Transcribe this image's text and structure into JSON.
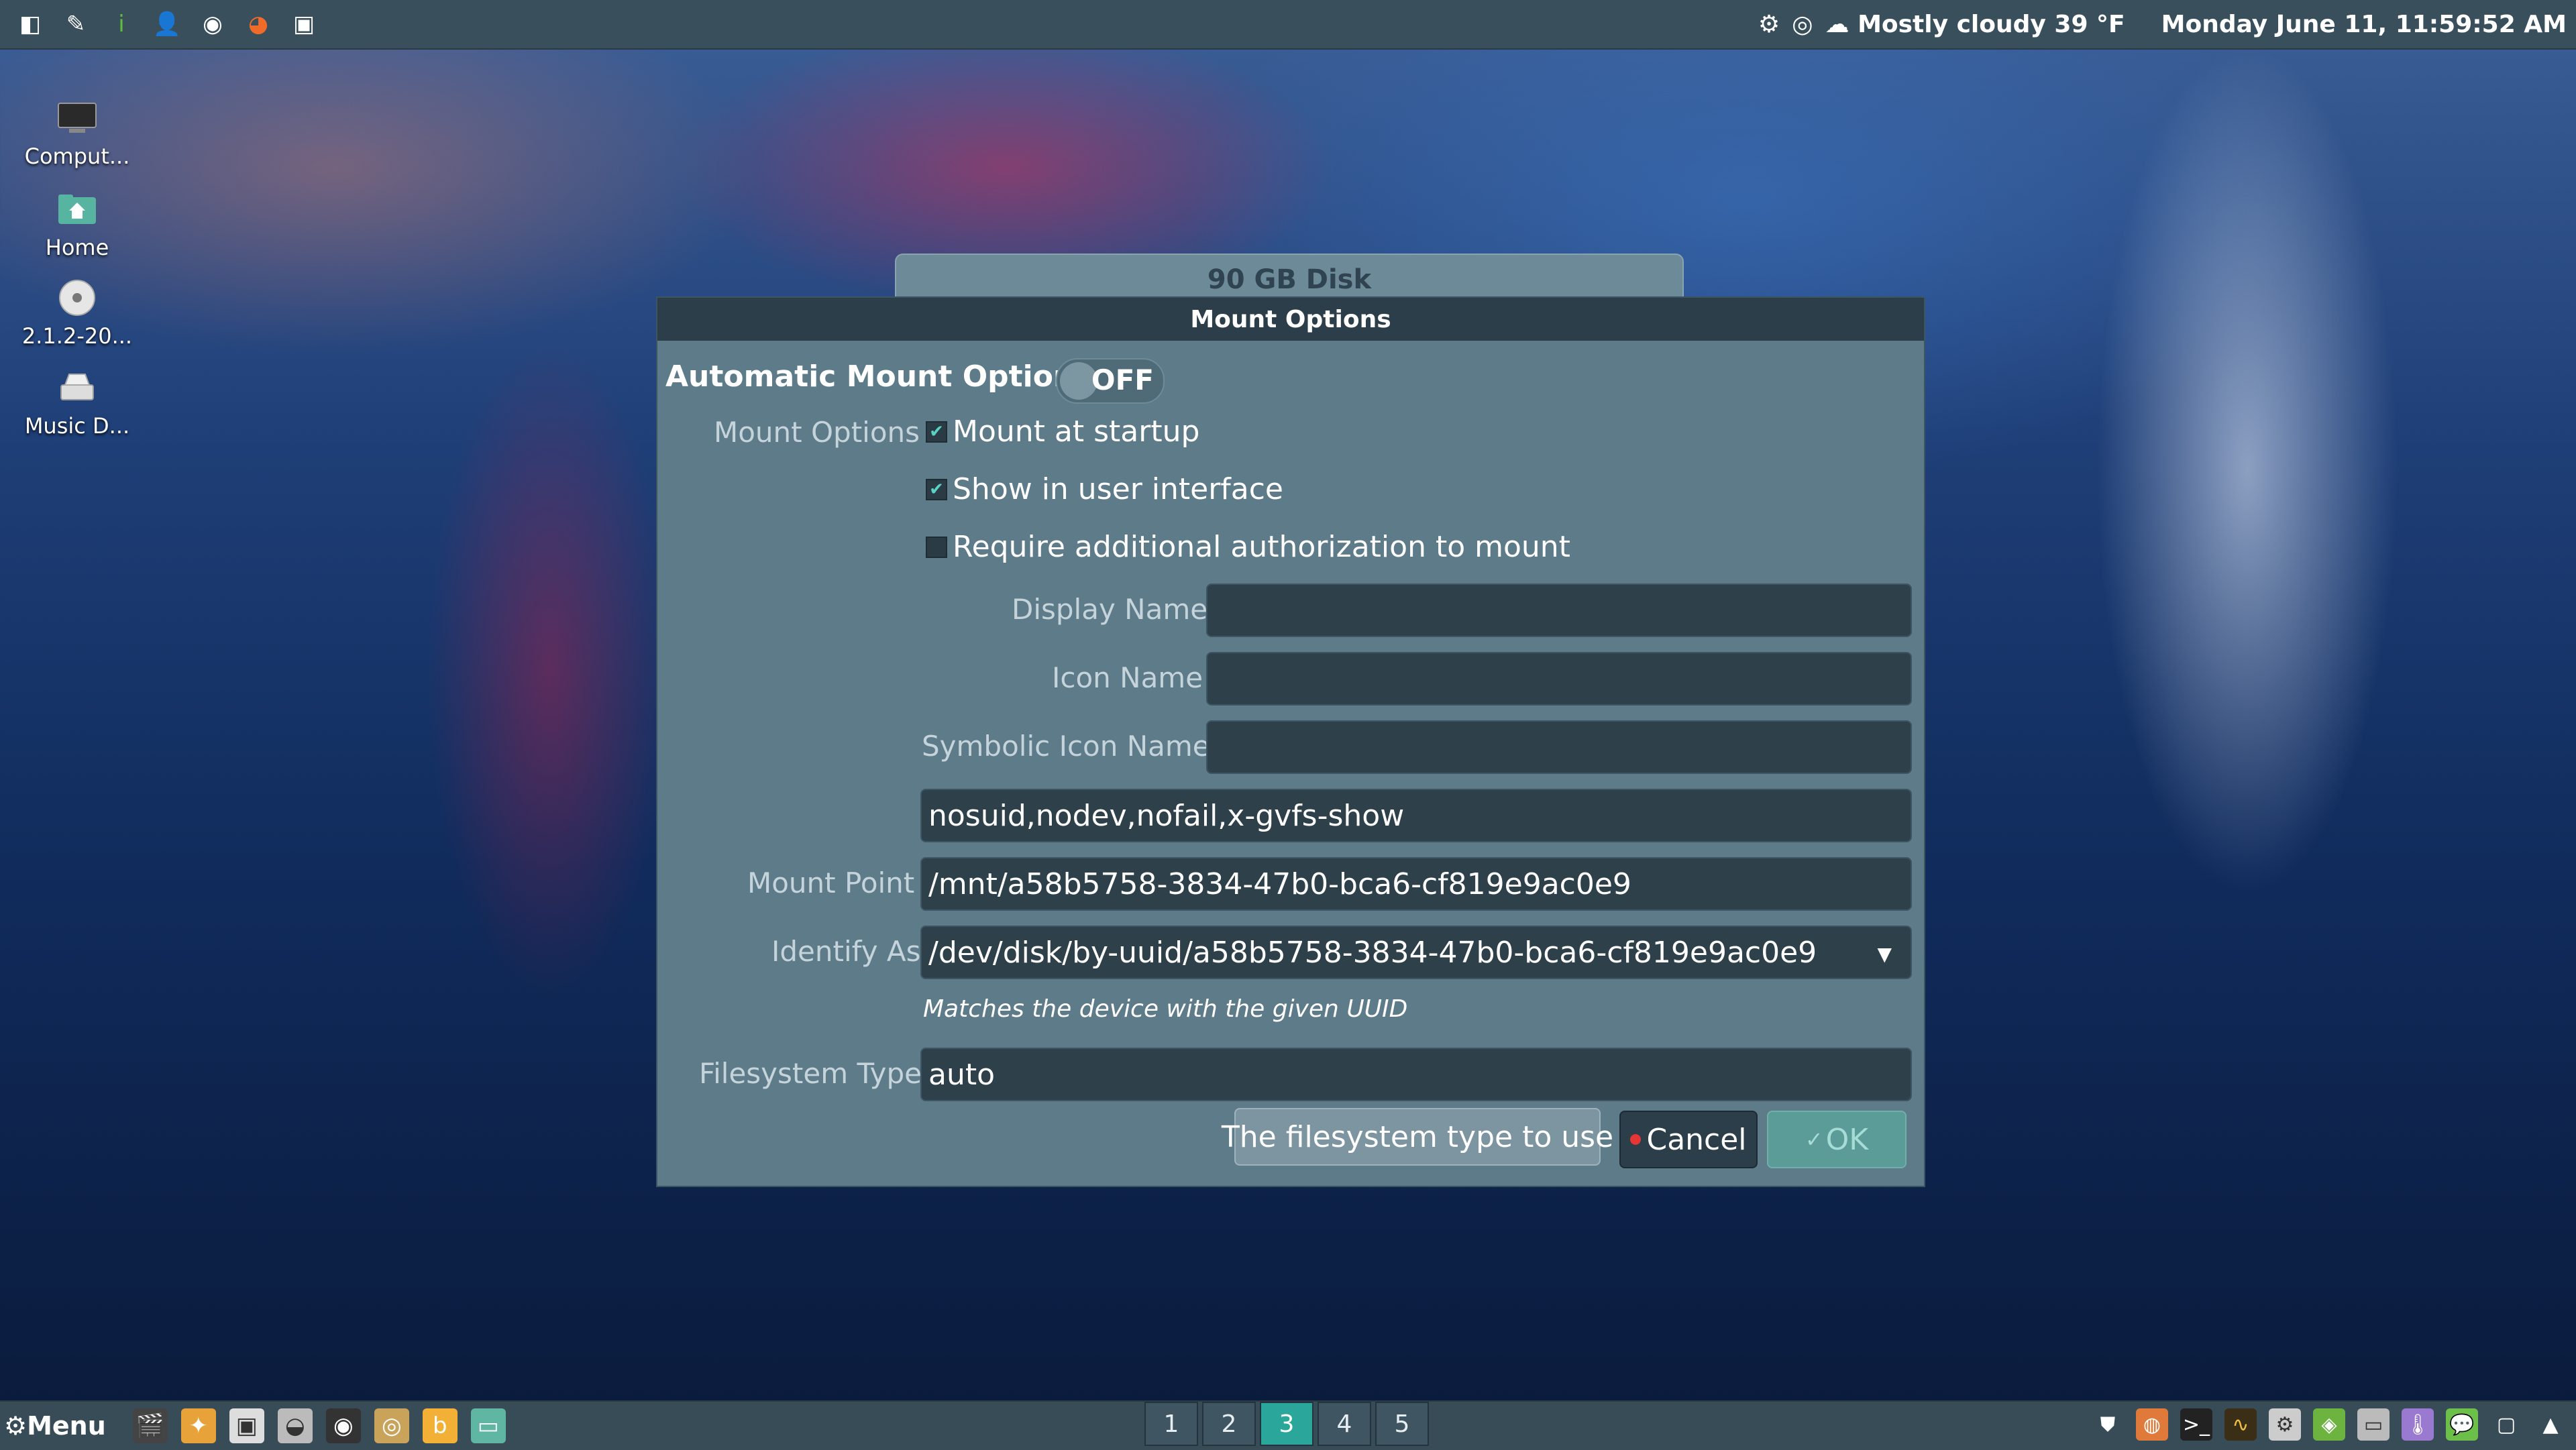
{
  "topbar": {
    "launchers": [
      {
        "icon": "file-manager-icon",
        "glyph": "◧",
        "color": "#ffffff"
      },
      {
        "icon": "pen-icon",
        "glyph": "✎",
        "color": "#ffffff"
      },
      {
        "icon": "info-icon",
        "glyph": "i",
        "color": "#5cbf3a"
      },
      {
        "icon": "user-icon",
        "glyph": "👤",
        "color": "#ffffff"
      },
      {
        "icon": "disc-icon",
        "glyph": "◉",
        "color": "#ffffff"
      },
      {
        "icon": "firefox-icon",
        "glyph": "◕",
        "color": "#f06a2a"
      },
      {
        "icon": "screenshot-icon",
        "glyph": "▣",
        "color": "#ffffff"
      }
    ],
    "tray_left": [
      "⚙",
      "◎"
    ],
    "weather": "Mostly cloudy 39 °F",
    "clock": "Monday June 11, 11:59:52 AM"
  },
  "desktop": {
    "icons": [
      {
        "name": "desktop-icon-computer",
        "label": "Comput...",
        "glyph": "computer-icon"
      },
      {
        "name": "desktop-icon-home",
        "label": "Home",
        "glyph": "home-folder-icon"
      },
      {
        "name": "desktop-icon-disc",
        "label": "2.1.2-20...",
        "glyph": "cd-icon"
      },
      {
        "name": "desktop-icon-music",
        "label": "Music D...",
        "glyph": "drive-icon"
      }
    ]
  },
  "background_window": {
    "title": "90 GB Disk"
  },
  "dialog": {
    "title": "Mount Options",
    "automatic_label": "Automatic Mount Options",
    "toggle_state": "OFF",
    "mount_options_label": "Mount Options",
    "checkboxes": [
      {
        "label": "Mount at startup",
        "checked": true
      },
      {
        "label": "Show in user interface",
        "checked": true
      },
      {
        "label": "Require additional authorization to mount",
        "checked": false
      }
    ],
    "display_name_label": "Display Name",
    "display_name_value": "",
    "icon_name_label": "Icon Name",
    "icon_name_value": "",
    "symbolic_icon_name_label": "Symbolic Icon Name",
    "symbolic_icon_name_value": "",
    "options_value": "nosuid,nodev,nofail,x-gvfs-show",
    "mount_point_label": "Mount Point",
    "mount_point_value": "/mnt/a58b5758-3834-47b0-bca6-cf819e9ac0e9",
    "identify_as_label": "Identify As",
    "identify_as_value": "/dev/disk/by-uuid/a58b5758-3834-47b0-bca6-cf819e9ac0e9",
    "identify_hint": "Matches the device with the given UUID",
    "filesystem_type_label": "Filesystem Type",
    "filesystem_type_value": "auto",
    "tooltip": "The filesystem type to use",
    "cancel_label": "Cancel",
    "ok_label": "OK"
  },
  "bottombar": {
    "menu_label": "Menu",
    "workspaces": [
      "1",
      "2",
      "3",
      "4",
      "5"
    ],
    "active_workspace": "3"
  }
}
